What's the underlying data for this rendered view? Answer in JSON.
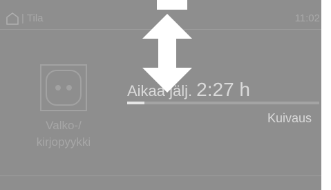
{
  "status_bar": {
    "breadcrumb_separator": "|",
    "breadcrumb": "Tila",
    "time": "11:02"
  },
  "program": {
    "name_line1": "Valko-/",
    "name_line2": "kirjopyykki",
    "icon": "cotton-program-icon"
  },
  "remaining": {
    "label": "Aikaa jälj.",
    "value": "2:27 h"
  },
  "progress": {
    "fraction": 0.09
  },
  "phase": "Kuivaus",
  "overlay": {
    "icon": "vertical-double-arrow-icon"
  },
  "colors": {
    "screen_background": "#8e8e8e",
    "text_bright": "#dadada",
    "text_dim": "#a9a9a9",
    "arrow": "#ffffff"
  }
}
